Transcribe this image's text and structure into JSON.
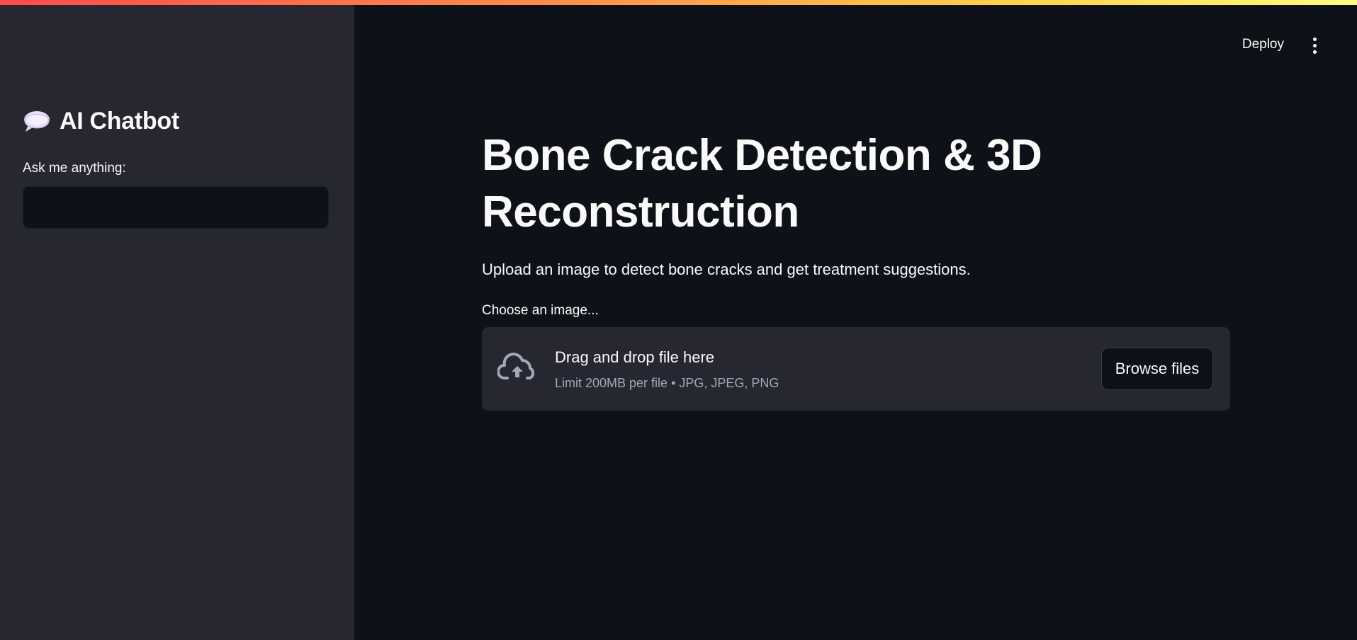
{
  "app": {
    "accent_gradient": [
      "#ff4b4b",
      "#ffd24b",
      "#fffd80"
    ],
    "background": "#0e1117",
    "sidebar_background": "#262730"
  },
  "sidebar": {
    "title_icon": "speech-balloon-icon",
    "title": "AI Chatbot",
    "input_label": "Ask me anything:",
    "input_value": ""
  },
  "header": {
    "deploy_label": "Deploy",
    "menu_icon": "kebab-menu-icon"
  },
  "main": {
    "title": "Bone Crack Detection & 3D Reconstruction",
    "subtitle": "Upload an image to detect bone cracks and get treatment suggestions.",
    "uploader": {
      "label": "Choose an image...",
      "icon": "cloud-upload-icon",
      "dropzone_title": "Drag and drop file here",
      "limit_text": "Limit 200MB per file • JPG, JPEG, PNG",
      "browse_label": "Browse files"
    }
  }
}
